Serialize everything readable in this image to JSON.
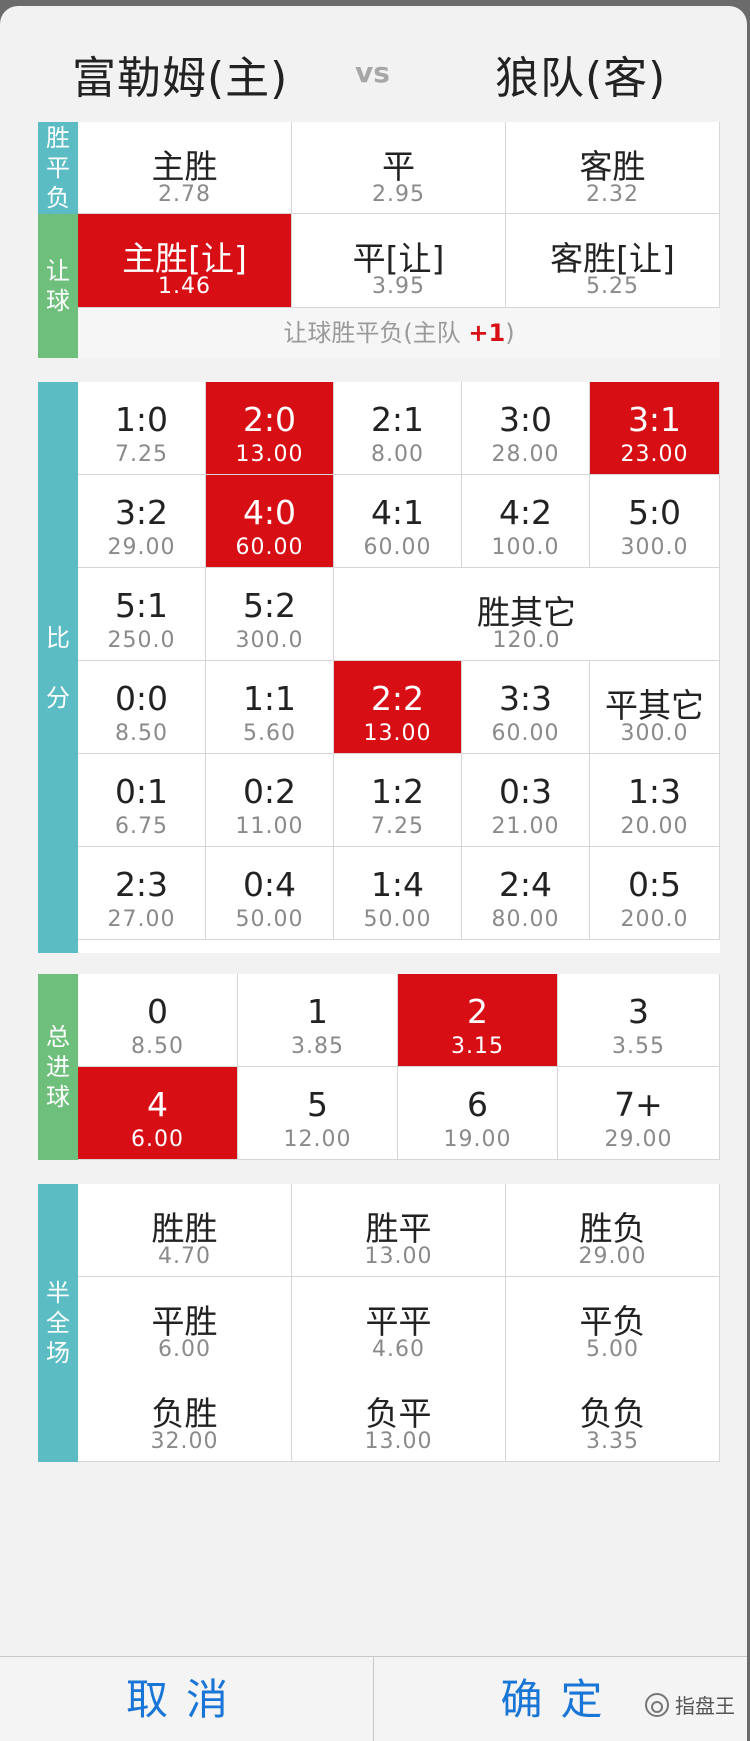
{
  "header": {
    "home": "富勒姆(主)",
    "vs": "vs",
    "away": "狼队(客)"
  },
  "spf": {
    "side": [
      "胜",
      "平",
      "负"
    ],
    "cells": [
      {
        "label": "主胜",
        "odds": "2.78",
        "selected": false
      },
      {
        "label": "平",
        "odds": "2.95",
        "selected": false
      },
      {
        "label": "客胜",
        "odds": "2.32",
        "selected": false
      }
    ]
  },
  "rq": {
    "side": [
      "让",
      "球"
    ],
    "cells": [
      {
        "label": "主胜[让]",
        "odds": "1.46",
        "selected": true
      },
      {
        "label": "平[让]",
        "odds": "3.95",
        "selected": false
      },
      {
        "label": "客胜[让]",
        "odds": "5.25",
        "selected": false
      }
    ],
    "note_prefix": "让球胜平负(主队 ",
    "note_handicap": "+1",
    "note_suffix": ")"
  },
  "bf": {
    "side": [
      "比",
      "分"
    ],
    "cells": [
      {
        "label": "1:0",
        "odds": "7.25",
        "selected": false
      },
      {
        "label": "2:0",
        "odds": "13.00",
        "selected": true
      },
      {
        "label": "2:1",
        "odds": "8.00",
        "selected": false
      },
      {
        "label": "3:0",
        "odds": "28.00",
        "selected": false
      },
      {
        "label": "3:1",
        "odds": "23.00",
        "selected": true
      },
      {
        "label": "3:2",
        "odds": "29.00",
        "selected": false
      },
      {
        "label": "4:0",
        "odds": "60.00",
        "selected": true
      },
      {
        "label": "4:1",
        "odds": "60.00",
        "selected": false
      },
      {
        "label": "4:2",
        "odds": "100.0",
        "selected": false
      },
      {
        "label": "5:0",
        "odds": "300.0",
        "selected": false
      },
      {
        "label": "5:1",
        "odds": "250.0",
        "selected": false
      },
      {
        "label": "5:2",
        "odds": "300.0",
        "selected": false
      },
      {
        "label": "胜其它",
        "odds": "120.0",
        "selected": false
      },
      {
        "label": "0:0",
        "odds": "8.50",
        "selected": false
      },
      {
        "label": "1:1",
        "odds": "5.60",
        "selected": false
      },
      {
        "label": "2:2",
        "odds": "13.00",
        "selected": true
      },
      {
        "label": "3:3",
        "odds": "60.00",
        "selected": false
      },
      {
        "label": "平其它",
        "odds": "300.0",
        "selected": false
      },
      {
        "label": "0:1",
        "odds": "6.75",
        "selected": false
      },
      {
        "label": "0:2",
        "odds": "11.00",
        "selected": false
      },
      {
        "label": "1:2",
        "odds": "7.25",
        "selected": false
      },
      {
        "label": "0:3",
        "odds": "21.00",
        "selected": false
      },
      {
        "label": "1:3",
        "odds": "20.00",
        "selected": false
      },
      {
        "label": "2:3",
        "odds": "27.00",
        "selected": false
      },
      {
        "label": "0:4",
        "odds": "50.00",
        "selected": false
      },
      {
        "label": "1:4",
        "odds": "50.00",
        "selected": false
      },
      {
        "label": "2:4",
        "odds": "80.00",
        "selected": false
      },
      {
        "label": "0:5",
        "odds": "200.0",
        "selected": false
      }
    ]
  },
  "zjq": {
    "side": [
      "总",
      "进",
      "球"
    ],
    "cells": [
      {
        "label": "0",
        "odds": "8.50",
        "selected": false
      },
      {
        "label": "1",
        "odds": "3.85",
        "selected": false
      },
      {
        "label": "2",
        "odds": "3.15",
        "selected": true
      },
      {
        "label": "3",
        "odds": "3.55",
        "selected": false
      },
      {
        "label": "4",
        "odds": "6.00",
        "selected": true
      },
      {
        "label": "5",
        "odds": "12.00",
        "selected": false
      },
      {
        "label": "6",
        "odds": "19.00",
        "selected": false
      },
      {
        "label": "7+",
        "odds": "29.00",
        "selected": false
      }
    ]
  },
  "bqc": {
    "side": [
      "半",
      "全",
      "场"
    ],
    "cells": [
      {
        "label": "胜胜",
        "odds": "4.70",
        "selected": false
      },
      {
        "label": "胜平",
        "odds": "13.00",
        "selected": false
      },
      {
        "label": "胜负",
        "odds": "29.00",
        "selected": false
      },
      {
        "label": "平胜",
        "odds": "6.00",
        "selected": false
      },
      {
        "label": "平平",
        "odds": "4.60",
        "selected": false
      },
      {
        "label": "平负",
        "odds": "5.00",
        "selected": false
      },
      {
        "label": "负胜",
        "odds": "32.00",
        "selected": false
      },
      {
        "label": "负平",
        "odds": "13.00",
        "selected": false
      },
      {
        "label": "负负",
        "odds": "3.35",
        "selected": false
      }
    ]
  },
  "footer": {
    "cancel": "取消",
    "confirm": "确定",
    "watermark": "指盘王"
  },
  "colors": {
    "selected": "#d80e15",
    "teal": "#5bbcc4",
    "green": "#6ebf7c",
    "button": "#1976d6"
  }
}
